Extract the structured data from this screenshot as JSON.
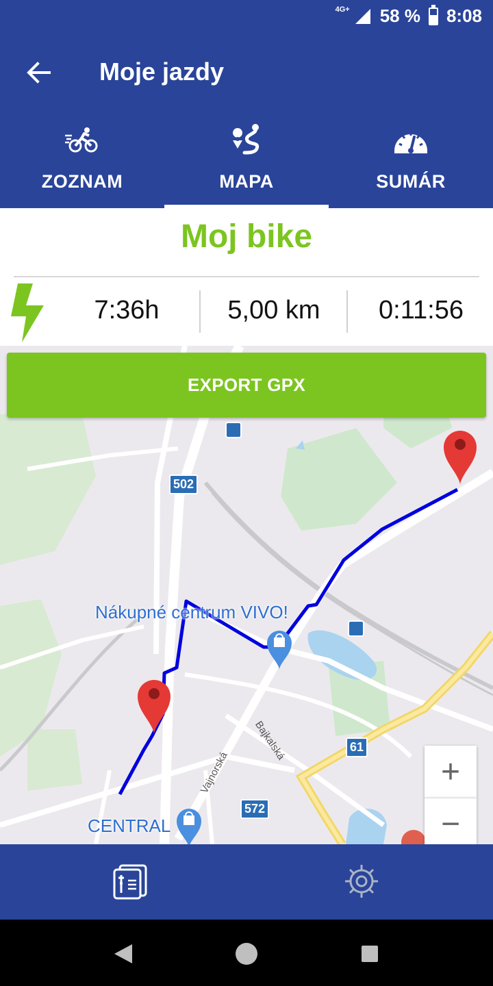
{
  "status": {
    "network": "4G+",
    "battery_percent": "58 %",
    "battery_level": 0.58,
    "time": "8:08"
  },
  "header": {
    "title": "Moje jazdy",
    "back_icon": "arrow-left-icon"
  },
  "tabs": [
    {
      "label": "ZOZNAM",
      "icon": "cyclist-icon",
      "active": false
    },
    {
      "label": "MAPA",
      "icon": "route-icon",
      "active": true
    },
    {
      "label": "SUMÁR",
      "icon": "speedometer-icon",
      "active": false
    }
  ],
  "bike": {
    "name": "Moj bike",
    "name_color": "#7cc520"
  },
  "stats": {
    "icon": "lightning-icon",
    "time_of_day": "7:36h",
    "distance": "5,00 km",
    "duration": "0:11:56"
  },
  "map": {
    "export_label": "EXPORT GPX",
    "places": [
      {
        "label": "Nákupné centrum VIVO!"
      },
      {
        "label": "CENTRAL"
      }
    ],
    "road_shields": [
      "502",
      "61",
      "572"
    ],
    "streets": [
      "Vajnorská",
      "Bajkalská"
    ],
    "zoom_in": "+",
    "zoom_out": "−",
    "route_color": "#0000dd",
    "marker_color": "#e53935"
  },
  "bottom_nav": [
    {
      "icon": "ride-log-icon"
    },
    {
      "icon": "settings-gear-icon"
    }
  ],
  "system_nav": [
    {
      "icon": "back-triangle-icon"
    },
    {
      "icon": "home-circle-icon"
    },
    {
      "icon": "recents-square-icon"
    }
  ],
  "colors": {
    "primary": "#2a4499",
    "accent": "#7cc520"
  }
}
